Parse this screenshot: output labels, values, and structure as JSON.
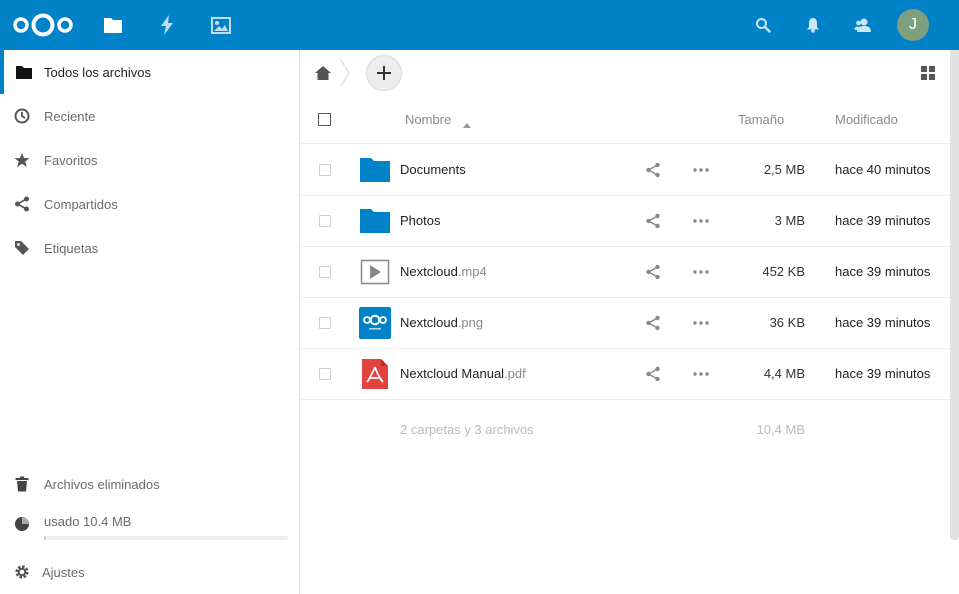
{
  "header": {
    "logo": "nextcloud-logo",
    "apps": [
      {
        "name": "files-icon"
      },
      {
        "name": "activity-icon"
      },
      {
        "name": "gallery-icon"
      }
    ],
    "right_icons": [
      {
        "name": "search-icon"
      },
      {
        "name": "notifications-icon"
      },
      {
        "name": "contacts-icon"
      }
    ],
    "avatar_initial": "J",
    "brand_color": "#0082c9"
  },
  "sidebar": {
    "items": [
      {
        "label": "Todos los archivos",
        "icon": "folder-icon",
        "active": true
      },
      {
        "label": "Reciente",
        "icon": "clock-icon"
      },
      {
        "label": "Favoritos",
        "icon": "star-icon"
      },
      {
        "label": "Compartidos",
        "icon": "share-icon"
      },
      {
        "label": "Etiquetas",
        "icon": "tag-icon"
      }
    ],
    "bottom": {
      "deleted": "Archivos eliminados",
      "quota": "usado 10.4 MB",
      "quota_fraction": 0.01,
      "settings": "Ajustes"
    }
  },
  "table": {
    "headers": {
      "name": "Nombre",
      "size": "Tamaño",
      "modified": "Modificado"
    },
    "rows": [
      {
        "name": "Documents",
        "ext": "",
        "type": "folder",
        "size": "2,5 MB",
        "modified": "hace 40 minutos"
      },
      {
        "name": "Photos",
        "ext": "",
        "type": "folder",
        "size": "3 MB",
        "modified": "hace 39 minutos"
      },
      {
        "name": "Nextcloud",
        "ext": ".mp4",
        "type": "video",
        "size": "452 KB",
        "modified": "hace 39 minutos"
      },
      {
        "name": "Nextcloud",
        "ext": ".png",
        "type": "image",
        "size": "36 KB",
        "modified": "hace 39 minutos"
      },
      {
        "name": "Nextcloud Manual",
        "ext": ".pdf",
        "type": "pdf",
        "size": "4,4 MB",
        "modified": "hace 39 minutos"
      }
    ],
    "summary": "2 carpetas y 3 archivos",
    "summary_size": "10,4 MB"
  }
}
